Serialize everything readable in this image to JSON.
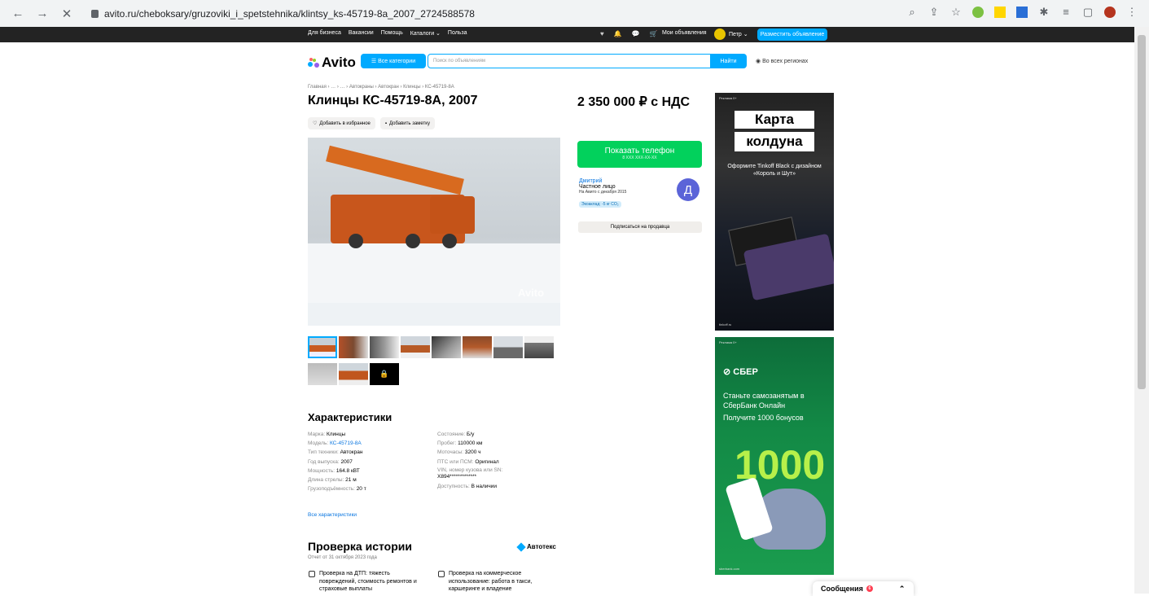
{
  "browser": {
    "url": "avito.ru/cheboksary/gruzoviki_i_spetstehnika/klintsy_ks-45719-8a_2007_2724588578"
  },
  "topbar": {
    "links": [
      "Для бизнеса",
      "Вакансии",
      "Помощь",
      "Каталоги ⌄",
      "Польза"
    ],
    "my_ads": "Мои объявления",
    "user": "Петр ⌄",
    "post_button": "Разместить объявление"
  },
  "header": {
    "logo": "Avito",
    "categories_button": "☰ Все категории",
    "search_placeholder": "Поиск по объявлениям",
    "find_button": "Найти",
    "region": "Во всех регионах"
  },
  "breadcrumbs": "Главная › … › … › Автокраны › Автокран › Клинцы › КС-45719-8А",
  "listing": {
    "title": "Клинцы КС-45719-8А, 2007",
    "price": "2 350 000 ₽ с НДС",
    "add_favorite": "Добавить в избранное",
    "add_note": "Добавить заметку",
    "watermark": "Avito",
    "thumb_count_row1": 8,
    "thumb_count_row2": 2
  },
  "contact": {
    "show_phone": "Показать телефон",
    "phone_mask": "8 XXX XXX-XX-XX",
    "seller_name": "Дмитрий",
    "seller_type": "Частное лицо",
    "seller_since": "На Авито с декабря 2015",
    "eco": "Экоаклад: -5 кг CO₂",
    "avatar_letter": "Д",
    "subscribe": "Подписаться на продавца"
  },
  "ads": {
    "ad1": {
      "label": "Реклама 0+",
      "title1": "Карта",
      "title2": "колдуна",
      "subtitle": "Оформите Tinkoff Black с дизайном «Король и Шут»",
      "footer": "tinkoff.ru"
    },
    "ad2": {
      "label": "Реклама 0+",
      "brand": "СБЕР",
      "text": "Станьте самозанятым в СберБанк Онлайн",
      "sub": "Получите 1000 бонусов",
      "big": "1000",
      "footer": "sberbank.com"
    }
  },
  "characteristics": {
    "heading": "Характеристики",
    "left": [
      {
        "k": "Марка: ",
        "v": "Клинцы"
      },
      {
        "k": "Модель: ",
        "v": "КС-45719-8А"
      },
      {
        "k": "Тип техники: ",
        "v": "Автокран"
      },
      {
        "k": "Год выпуска: ",
        "v": "2007"
      },
      {
        "k": "Мощность: ",
        "v": "164.8 кВТ"
      },
      {
        "k": "Длина стрелы: ",
        "v": "21 м"
      },
      {
        "k": "Грузоподъёмность: ",
        "v": "20 т"
      }
    ],
    "right": [
      {
        "k": "Состояние: ",
        "v": "Б/у"
      },
      {
        "k": "Пробег: ",
        "v": "110000 км"
      },
      {
        "k": "Моточасы: ",
        "v": "3200 ч"
      },
      {
        "k": "ПТС или ПСМ: ",
        "v": "Оригинал"
      },
      {
        "k": "VIN, номер кузова или SN: ",
        "v": "X894*************"
      },
      {
        "k": "Доступность: ",
        "v": "В наличии"
      }
    ],
    "all_link": "Все характеристики"
  },
  "history": {
    "heading": "Проверка истории",
    "subtitle": "Отчет от 31 октября 2023 года",
    "brand": "Автотекс",
    "check1": "Проверка на ДТП: тяжесть повреждений, стоимость ремонтов и страховые выплаты",
    "check2": "Проверка на коммерческое использование: работа в такси, каршеринге и владение"
  },
  "messages": {
    "label": "Сообщения",
    "count": "6"
  }
}
